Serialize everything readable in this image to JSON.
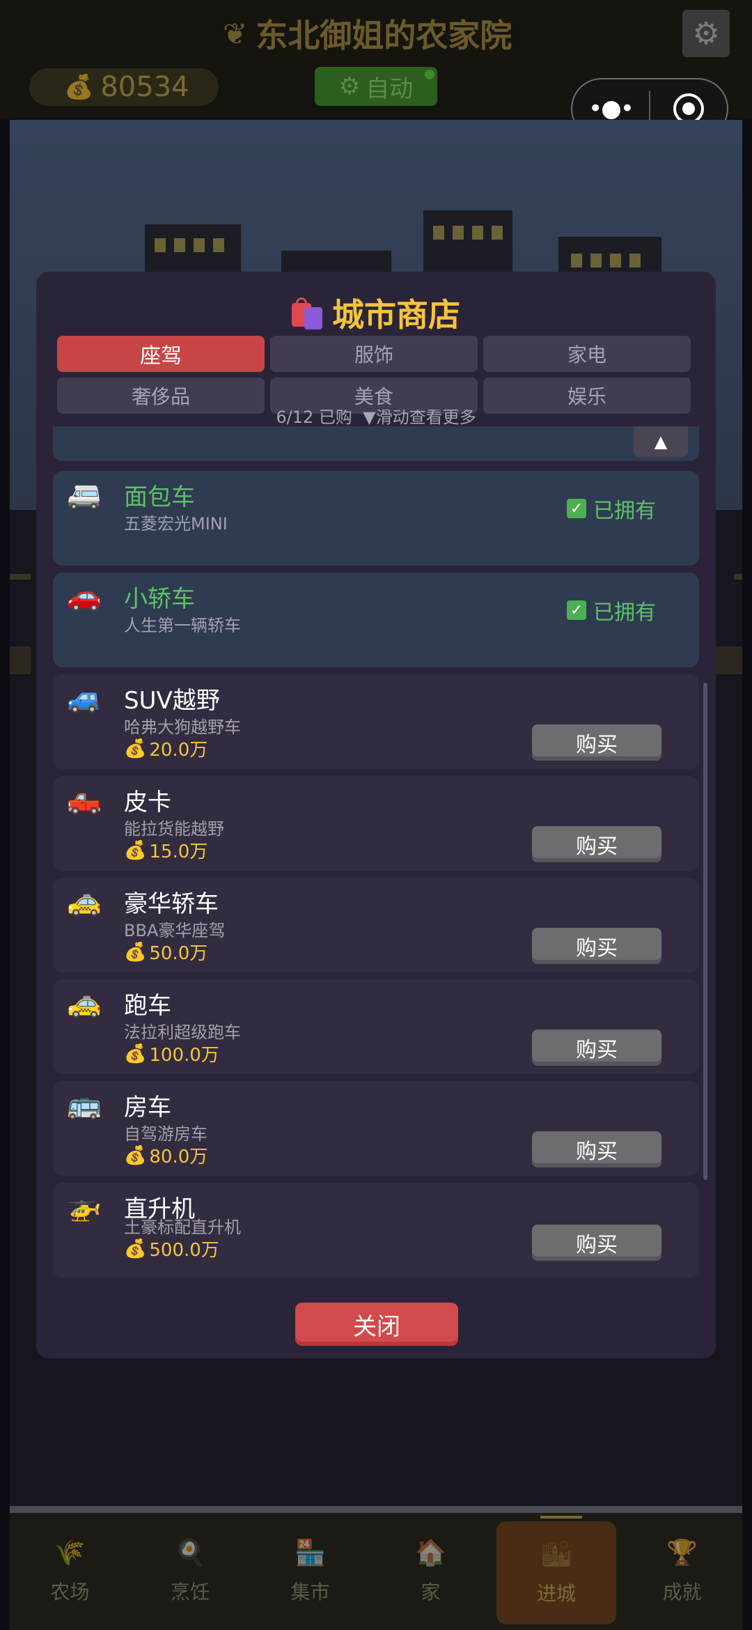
{
  "app": {
    "title": "东北御姐的农家院",
    "coins": "80534",
    "auto_label": "自动"
  },
  "modal": {
    "title": "城市商店",
    "tabs": [
      {
        "label": "座驾",
        "active": true
      },
      {
        "label": "服饰",
        "active": false
      },
      {
        "label": "家电",
        "active": false
      },
      {
        "label": "奢侈品",
        "active": false
      },
      {
        "label": "美食",
        "active": false
      },
      {
        "label": "娱乐",
        "active": false
      }
    ],
    "purchase_count": "6/12 已购",
    "scroll_hint": "▼滑动查看更多",
    "owned_label": "已拥有",
    "buy_label": "购买",
    "close_label": "关闭",
    "items": [
      {
        "icon": "minibus-icon",
        "glyph": "🚐",
        "name": "面包车",
        "desc": "五菱宏光MINI",
        "owned": true
      },
      {
        "icon": "car-icon",
        "glyph": "🚗",
        "name": "小轿车",
        "desc": "人生第一辆轿车",
        "owned": true
      },
      {
        "icon": "suv-icon",
        "glyph": "🚙",
        "name": "SUV越野",
        "desc": "哈弗大狗越野车",
        "price": "20.0万",
        "owned": false
      },
      {
        "icon": "pickup-truck-icon",
        "glyph": "🛻",
        "name": "皮卡",
        "desc": "能拉货能越野",
        "price": "15.0万",
        "owned": false
      },
      {
        "icon": "luxury-car-icon",
        "glyph": "🚕",
        "name": "豪华轿车",
        "desc": "BBA豪华座驾",
        "price": "50.0万",
        "owned": false
      },
      {
        "icon": "sports-car-icon",
        "glyph": "🚕",
        "name": "跑车",
        "desc": "法拉利超级跑车",
        "price": "100.0万",
        "owned": false
      },
      {
        "icon": "rv-icon",
        "glyph": "🚌",
        "name": "房车",
        "desc": "自驾游房车",
        "price": "80.0万",
        "owned": false
      },
      {
        "icon": "helicopter-icon",
        "glyph": "🚁",
        "name": "直升机",
        "desc": "土豪标配直升机",
        "price": "500.0万",
        "owned": false
      }
    ]
  },
  "nav": [
    {
      "label": "农场",
      "icon": "wheat-icon",
      "glyph": "🌾",
      "active": false
    },
    {
      "label": "烹饪",
      "icon": "cooking-icon",
      "glyph": "🍳",
      "active": false
    },
    {
      "label": "集市",
      "icon": "market-icon",
      "glyph": "🏪",
      "active": false
    },
    {
      "label": "家",
      "icon": "home-icon",
      "glyph": "🏠",
      "active": false
    },
    {
      "label": "进城",
      "icon": "city-icon",
      "glyph": "🏙",
      "active": true
    },
    {
      "label": "成就",
      "icon": "trophy-icon",
      "glyph": "🏆",
      "active": false
    }
  ],
  "colors": {
    "accent_gold": "#f4c53a",
    "tab_active": "#c84545",
    "owned_green": "#5cc166",
    "modal_bg": "#2b2438"
  }
}
